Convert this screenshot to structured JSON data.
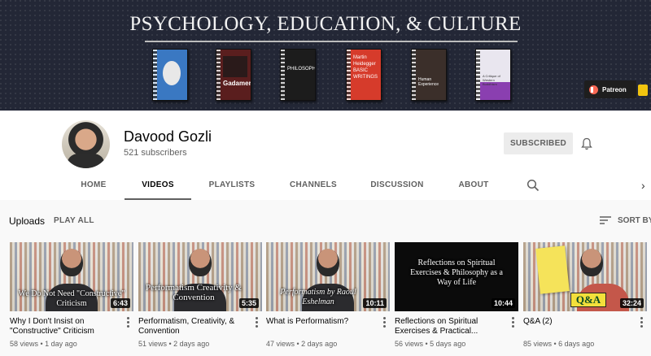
{
  "banner": {
    "title": "PSYCHOLOGY, EDUCATION, & CULTURE",
    "books": [
      {
        "text": "",
        "color": "#3a78c2"
      },
      {
        "text": "Gadamer",
        "color": "#5a1e1e"
      },
      {
        "text": "PHILOSOPHY",
        "color": "#1c1c1c"
      },
      {
        "text": "Martin Heidegger BASIC WRITINGS",
        "color": "#d63b2b"
      },
      {
        "text": "Human Experience",
        "color": "#3b2f2a"
      },
      {
        "text": "A Critique of Western Buddhism",
        "color": "#e9e6ef"
      }
    ],
    "patreon_label": "Patreon"
  },
  "channel": {
    "name": "Davood Gozli",
    "subscribers": "521 subscribers",
    "subscribed_label": "SUBSCRIBED"
  },
  "tabs": [
    "HOME",
    "VIDEOS",
    "PLAYLISTS",
    "CHANNELS",
    "DISCUSSION",
    "ABOUT"
  ],
  "active_tab": "VIDEOS",
  "uploads": {
    "label": "Uploads",
    "play_all": "PLAY ALL",
    "sort_by": "SORT BY"
  },
  "videos": [
    {
      "title": "Why I Don't Insist on \"Constructive\" Criticism",
      "meta": "58 views • 1 day ago",
      "duration": "6:43",
      "thumb_text": "We Do Not Need \"Constructive\" Criticism"
    },
    {
      "title": "Performatism, Creativity, & Convention",
      "meta": "51 views • 2 days ago",
      "duration": "5:35",
      "thumb_text": "Performatism Creativity & Convention"
    },
    {
      "title": "What is Performatism?",
      "meta": "47 views • 2 days ago",
      "duration": "10:11",
      "thumb_text": "Performatism by Raoul Eshelman"
    },
    {
      "title": "Reflections on Spiritual Exercises & Practical...",
      "meta": "56 views • 5 days ago",
      "duration": "10:44",
      "thumb_text": "Reflections on Spiritual Exercises & Philosophy as a Way of Life"
    },
    {
      "title": "Q&A (2)",
      "meta": "85 views • 6 days ago",
      "duration": "32:24",
      "thumb_text": "Q&A"
    }
  ]
}
